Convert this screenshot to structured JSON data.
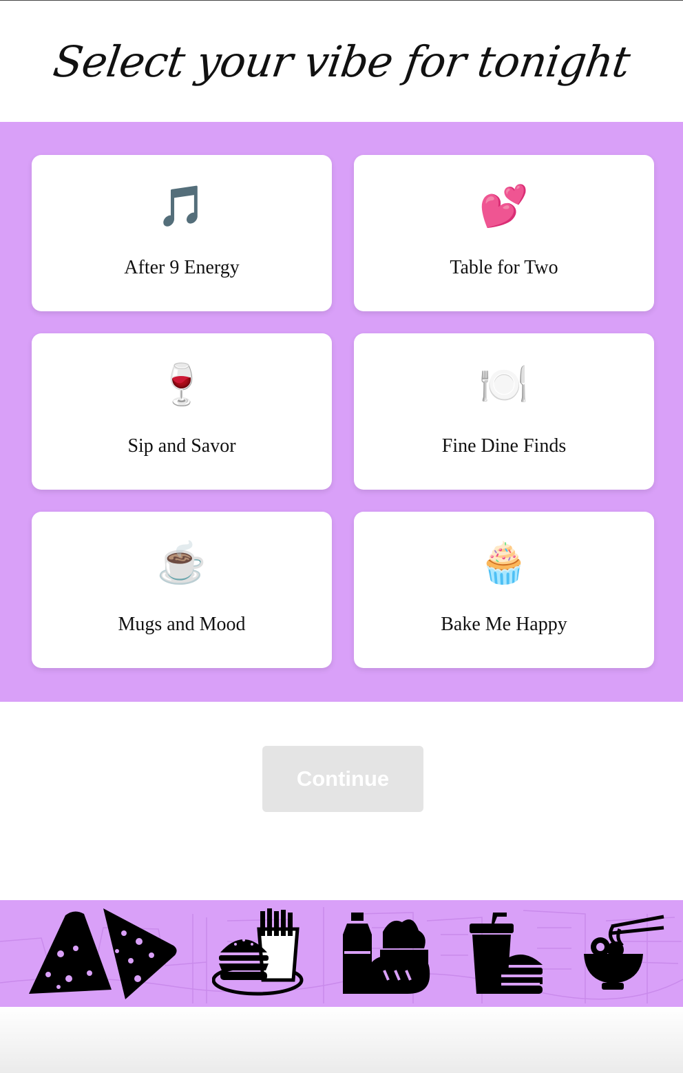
{
  "page": {
    "title": "Select your vibe for tonight"
  },
  "vibes": [
    {
      "label": "After 9 Energy",
      "emoji": "🎵",
      "icon": "music-notes-icon"
    },
    {
      "label": "Table for Two",
      "emoji": "💕",
      "icon": "two-hearts-icon"
    },
    {
      "label": "Sip and Savor",
      "emoji": "🍷",
      "icon": "wine-glass-icon"
    },
    {
      "label": "Fine Dine Finds",
      "emoji": "🍽️",
      "icon": "plate-cutlery-icon"
    },
    {
      "label": "Mugs and Mood",
      "emoji": "☕",
      "icon": "coffee-cup-icon"
    },
    {
      "label": "Bake Me Happy",
      "emoji": "🧁",
      "icon": "cupcake-icon"
    }
  ],
  "actions": {
    "continue_label": "Continue",
    "continue_enabled": false
  },
  "banner": {
    "icons": [
      "pizza-slices-icon",
      "burger-fries-icon",
      "grocery-bottle-bread-icon",
      "drink-burger-icon",
      "noodle-bowl-icon"
    ]
  },
  "colors": {
    "accent": "#d9a0f8",
    "card": "#ffffff",
    "button_disabled": "#e4e4e4",
    "text": "#111111"
  }
}
